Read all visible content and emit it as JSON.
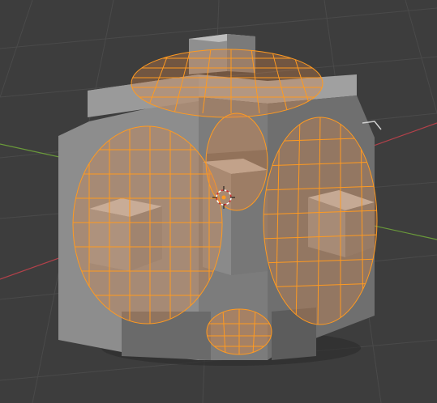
{
  "viewport": {
    "background": "#3d3d3d",
    "grid_color": "#4a4a4a",
    "axis_x_color": "#b3414a",
    "axis_y_color": "#6a9a3a"
  },
  "model": {
    "shape": "cube-with-protruding-sphere-wireframes",
    "body_color": "#8e8e8e",
    "highlight_color": "#a3a3a3",
    "shadow_color": "#5a5a5a",
    "selection_color": "#ff9a20",
    "selection_fill": "#d6884a"
  },
  "overlay": {
    "origin_icon": "3d-cursor-icon"
  }
}
